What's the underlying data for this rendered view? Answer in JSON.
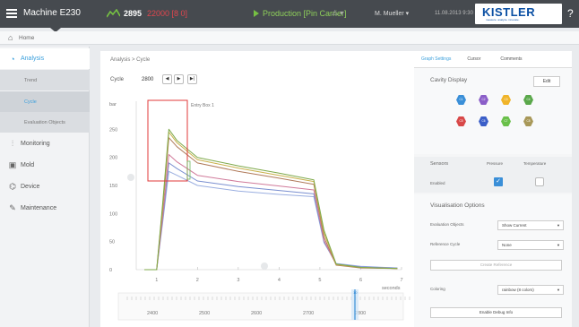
{
  "header": {
    "machine": "Machine E230",
    "count": "2895",
    "count_extra": "22000 [8 0]",
    "production": "Production [Pin Carrier]",
    "production_warn": "⚠ ▾",
    "user": "M. Mueller ▾",
    "datetime": "11.08.2013  9:30 am",
    "logo": "KISTLER",
    "logo_tagline": "measure. analyze. innovate.",
    "help": "?"
  },
  "home": {
    "label": "Home"
  },
  "sidebar": {
    "items": [
      {
        "label": "Analysis"
      },
      {
        "label": "Trend"
      },
      {
        "label": "Cycle"
      },
      {
        "label": "Evaluation Objects"
      },
      {
        "label": "Monitoring"
      },
      {
        "label": "Mold"
      },
      {
        "label": "Device"
      },
      {
        "label": "Maintenance"
      }
    ]
  },
  "main": {
    "breadcrumb": "Analysis > Cycle",
    "cycle_label": "Cycle",
    "cycle_value": "2800",
    "btn_prev": "◀",
    "btn_next": "▶",
    "btn_last": "▶|"
  },
  "chart_data": {
    "type": "line",
    "ylabel": "bar",
    "xlabel": "seconds",
    "xlim": [
      0.5,
      7
    ],
    "ylim": [
      0,
      300
    ],
    "x_ticks": [
      "1",
      "2",
      "3",
      "4",
      "5",
      "6",
      "7"
    ],
    "y_ticks": [
      "0",
      "50",
      "100",
      "150",
      "200",
      "250"
    ],
    "annotation": "Entry Box 1",
    "series_colors": [
      "#7ea94a",
      "#c9b04a",
      "#b07a5a",
      "#d07a9a",
      "#7a8fd0",
      "#9aaee0"
    ],
    "series": [
      {
        "values": [
          [
            0.7,
            0
          ],
          [
            1.0,
            0
          ],
          [
            1.15,
            120
          ],
          [
            1.3,
            250
          ],
          [
            1.5,
            230
          ],
          [
            2,
            200
          ],
          [
            3,
            185
          ],
          [
            4,
            172
          ],
          [
            4.85,
            160
          ],
          [
            5.1,
            70
          ],
          [
            5.4,
            10
          ],
          [
            6,
            4
          ],
          [
            6.9,
            2
          ]
        ]
      },
      {
        "values": [
          [
            0.7,
            0
          ],
          [
            1.0,
            0
          ],
          [
            1.15,
            115
          ],
          [
            1.3,
            245
          ],
          [
            1.5,
            226
          ],
          [
            2,
            196
          ],
          [
            3,
            181
          ],
          [
            4,
            168
          ],
          [
            4.85,
            157
          ],
          [
            5.1,
            65
          ],
          [
            5.4,
            9
          ],
          [
            6,
            4
          ],
          [
            6.9,
            2
          ]
        ]
      },
      {
        "values": [
          [
            0.7,
            0
          ],
          [
            1.0,
            0
          ],
          [
            1.15,
            108
          ],
          [
            1.3,
            235
          ],
          [
            1.5,
            219
          ],
          [
            2,
            190
          ],
          [
            3,
            175
          ],
          [
            4,
            163
          ],
          [
            4.85,
            152
          ],
          [
            5.1,
            58
          ],
          [
            5.4,
            8
          ],
          [
            6,
            3
          ],
          [
            6.9,
            2
          ]
        ]
      },
      {
        "values": [
          [
            0.7,
            0
          ],
          [
            1.0,
            0
          ],
          [
            1.15,
            95
          ],
          [
            1.3,
            205
          ],
          [
            1.5,
            192
          ],
          [
            2,
            168
          ],
          [
            3,
            157
          ],
          [
            4,
            149
          ],
          [
            4.85,
            142
          ],
          [
            5.1,
            52
          ],
          [
            5.4,
            9
          ],
          [
            6,
            4
          ],
          [
            6.9,
            2
          ]
        ]
      },
      {
        "values": [
          [
            0.7,
            0
          ],
          [
            1.0,
            0
          ],
          [
            1.15,
            90
          ],
          [
            1.3,
            190
          ],
          [
            1.5,
            180
          ],
          [
            2,
            158
          ],
          [
            3,
            148
          ],
          [
            4,
            141
          ],
          [
            4.85,
            135
          ],
          [
            5.1,
            50
          ],
          [
            5.4,
            10
          ],
          [
            6,
            5
          ],
          [
            6.9,
            3
          ]
        ]
      },
      {
        "values": [
          [
            0.7,
            0
          ],
          [
            1.0,
            0
          ],
          [
            1.15,
            85
          ],
          [
            1.3,
            175
          ],
          [
            1.5,
            168
          ],
          [
            2,
            150
          ],
          [
            3,
            140
          ],
          [
            4,
            134
          ],
          [
            4.85,
            130
          ],
          [
            5.1,
            48
          ],
          [
            5.4,
            11
          ],
          [
            6,
            6
          ],
          [
            6.9,
            3
          ]
        ]
      }
    ],
    "scroll_ticks": [
      "2400",
      "2500",
      "2600",
      "2700",
      "2800"
    ],
    "scroll_marker": "10"
  },
  "right_panel": {
    "tabs": [
      "Graph Settings",
      "Cursor",
      "Comments"
    ],
    "cavity_title": "Cavity Display",
    "edit": "Edit",
    "cavities": [
      {
        "label": "C1",
        "color": "#3a8fd8"
      },
      {
        "label": "C2",
        "color": "#8a5ec8"
      },
      {
        "label": "C3",
        "color": "#f0b429"
      },
      {
        "label": "C4",
        "color": "#5aa84a"
      },
      {
        "label": "C5",
        "color": "#d84848"
      },
      {
        "label": "C6",
        "color": "#3a5ec8"
      },
      {
        "label": "C7",
        "color": "#6ac04a"
      },
      {
        "label": "C8",
        "color": "#a89858"
      }
    ],
    "sensors_label": "Sensors",
    "pressure_label": "Pressure",
    "temperature_label": "Temperature",
    "enabled_label": "Enabled",
    "vis_title": "Visualisation Options",
    "eval_label": "Evaluation Objects",
    "eval_value": "Show Current",
    "ref_label": "Reference Cycle",
    "ref_value": "None",
    "create_ref": "Create Reference",
    "coloring_label": "Coloring",
    "coloring_value": "rainbow (8 colors)",
    "debug": "Enable Debug Info"
  }
}
